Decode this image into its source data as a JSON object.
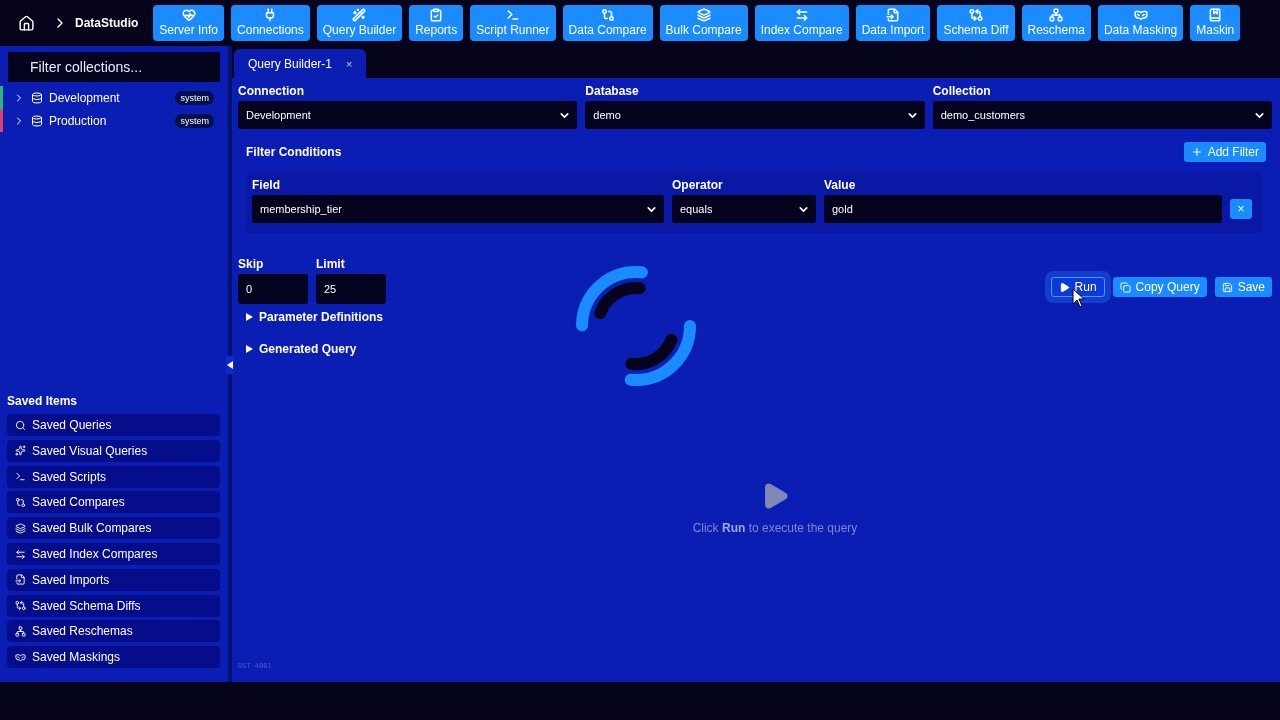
{
  "breadcrumb": {
    "title": "DataStudio"
  },
  "nav": [
    {
      "label": "Server Info"
    },
    {
      "label": "Connections"
    },
    {
      "label": "Query Builder"
    },
    {
      "label": "Reports"
    },
    {
      "label": "Script Runner"
    },
    {
      "label": "Data Compare"
    },
    {
      "label": "Bulk Compare"
    },
    {
      "label": "Index Compare"
    },
    {
      "label": "Data Import"
    },
    {
      "label": "Schema Diff"
    },
    {
      "label": "Reschema"
    },
    {
      "label": "Data Masking"
    },
    {
      "label": "Maskin"
    }
  ],
  "sidebar": {
    "filter": {
      "placeholder": "Filter collections..."
    },
    "connections": [
      {
        "name": "Development",
        "badge": "system",
        "color": "#2fb27e",
        "expanded": false
      },
      {
        "name": "Production",
        "badge": "system",
        "color": "#d9456e",
        "expanded": false
      }
    ],
    "saved_title": "Saved Items",
    "saved_items": [
      {
        "label": "Saved Queries"
      },
      {
        "label": "Saved Visual Queries"
      },
      {
        "label": "Saved Scripts"
      },
      {
        "label": "Saved Compares"
      },
      {
        "label": "Saved Bulk Compares"
      },
      {
        "label": "Saved Index Compares"
      },
      {
        "label": "Saved Imports"
      },
      {
        "label": "Saved Schema Diffs"
      },
      {
        "label": "Saved Reschemas"
      },
      {
        "label": "Saved Maskings"
      }
    ]
  },
  "tabs": [
    {
      "label": "Query Builder-1",
      "close": "×",
      "selected": true
    }
  ],
  "selectors": [
    {
      "label": "Connection",
      "value": "Development"
    },
    {
      "label": "Database",
      "value": "demo"
    },
    {
      "label": "Collection",
      "value": "demo_customers"
    }
  ],
  "filters": {
    "title": "Filter Conditions",
    "add_button": "Add Filter",
    "rows": [
      {
        "field_label": "Field",
        "field": "membership_tier",
        "operator_label": "Operator",
        "operator": "equals",
        "value_label": "Value",
        "value": "gold",
        "remove": "×"
      }
    ]
  },
  "paging": [
    {
      "label": "Skip",
      "value": "0"
    },
    {
      "label": "Limit",
      "value": "25"
    }
  ],
  "sections": [
    {
      "label": "Parameter Definitions",
      "expanded": false
    },
    {
      "label": "Generated Query",
      "expanded": false
    }
  ],
  "actions": [
    {
      "label": "Run",
      "kind": "run",
      "focused": true
    },
    {
      "label": "Copy Query",
      "kind": "copy",
      "focused": false
    },
    {
      "label": "Save",
      "kind": "save",
      "focused": false
    }
  ],
  "loading": true,
  "empty_state": {
    "message": "Click **Run** to execute the query"
  },
  "footer_code": "DST-4061"
}
